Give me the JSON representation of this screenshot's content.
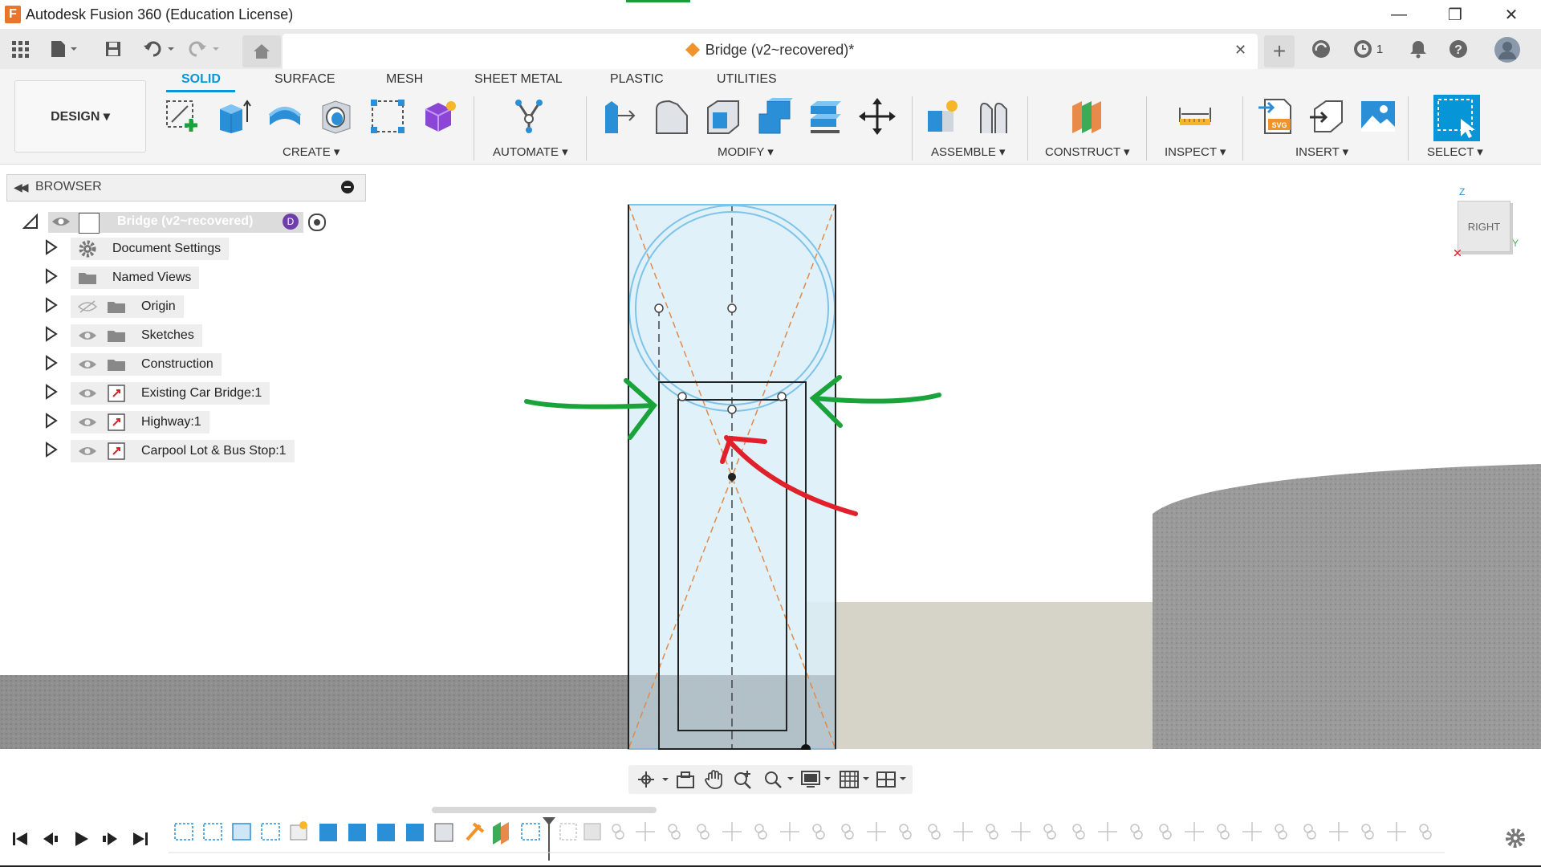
{
  "window": {
    "title": "Autodesk Fusion 360 (Education License)",
    "logo_letter": "F",
    "minimize": "—",
    "maximize": "❐",
    "close": "✕"
  },
  "document": {
    "tab_title": "Bridge (v2~recovered)*",
    "tab_close": "✕",
    "job_count": "1"
  },
  "workspace": {
    "label": "DESIGN ▾"
  },
  "ribbon": {
    "tabs": [
      "SOLID",
      "SURFACE",
      "MESH",
      "SHEET METAL",
      "PLASTIC",
      "UTILITIES"
    ],
    "active_tab": "SOLID",
    "groups": [
      "CREATE ▾",
      "AUTOMATE ▾",
      "MODIFY ▾",
      "ASSEMBLE ▾",
      "CONSTRUCT ▾",
      "INSPECT ▾",
      "INSERT ▾",
      "SELECT ▾"
    ]
  },
  "browser": {
    "title": "BROWSER",
    "root": "Bridge (v2~recovered)",
    "items": [
      {
        "label": "Document Settings",
        "icon": "gear-icon"
      },
      {
        "label": "Named Views",
        "icon": "folder-icon"
      },
      {
        "label": "Origin",
        "icon": "folder-icon"
      },
      {
        "label": "Sketches",
        "icon": "folder-icon"
      },
      {
        "label": "Construction",
        "icon": "folder-icon"
      },
      {
        "label": "Existing Car Bridge:1",
        "icon": "component-icon"
      },
      {
        "label": "Highway:1",
        "icon": "component-icon"
      },
      {
        "label": "Carpool Lot & Bus Stop:1",
        "icon": "component-icon"
      }
    ]
  },
  "viewcube": {
    "face": "RIGHT",
    "axis_z": "Z",
    "axis_y": "Y"
  },
  "colors": {
    "accent": "#0696d7",
    "annotation_green": "#1aa33a",
    "annotation_red": "#e0202a",
    "sketch_fill": "#dbeef8",
    "ground": "#8c8c8c",
    "slab": "#d6d4c8"
  }
}
